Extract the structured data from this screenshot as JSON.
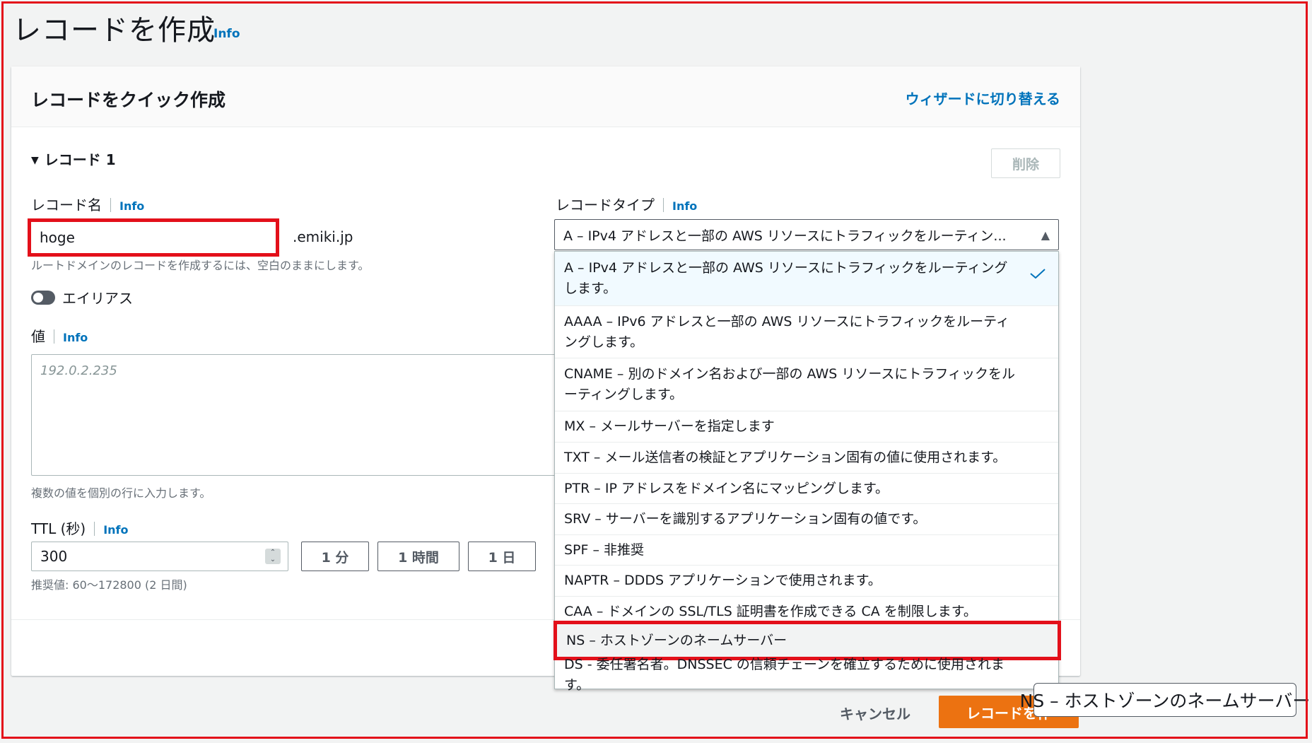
{
  "page": {
    "title": "レコードを作成",
    "info_label": "Info"
  },
  "panel": {
    "title": "レコードをクイック作成",
    "wizard_link": "ウィザードに切り替える"
  },
  "record": {
    "section_label": "レコード 1",
    "delete_label": "削除",
    "name": {
      "label": "レコード名",
      "info": "Info",
      "value": "hoge",
      "domain_suffix": ".emiki.jp",
      "hint": "ルートドメインのレコードを作成するには、空白のままにします。"
    },
    "alias": {
      "label": "エイリアス",
      "enabled": false
    },
    "value": {
      "label": "値",
      "info": "Info",
      "placeholder": "192.0.2.235",
      "hint": "複数の値を個別の行に入力します。"
    },
    "ttl": {
      "label": "TTL (秒)",
      "info": "Info",
      "value": "300",
      "presets": [
        "1 分",
        "1 時間",
        "1 日"
      ],
      "hint": "推奨値: 60～172800 (2 日間)"
    },
    "type": {
      "label": "レコードタイプ",
      "info": "Info",
      "selected": "A – IPv4 アドレスと一部の AWS リソースにトラフィックをルーティングします。",
      "selected_display": "A – IPv4 アドレスと一部の AWS リソースにトラフィックをルーティン...",
      "options": [
        "A – IPv4 アドレスと一部の AWS リソースにトラフィックをルーティングします。",
        "AAAA – IPv6 アドレスと一部の AWS リソースにトラフィックをルーティングします。",
        "CNAME – 別のドメイン名および一部の AWS リソースにトラフィックをルーティングします。",
        "MX – メールサーバーを指定します",
        "TXT – メール送信者の検証とアプリケーション固有の値に使用されます。",
        "PTR – IP アドレスをドメイン名にマッピングします。",
        "SRV – サーバーを識別するアプリケーション固有の値です。",
        "SPF – 非推奨",
        "NAPTR – DDDS アプリケーションで使用されます。",
        "CAA – ドメインの SSL/TLS 証明書を作成できる CA を制限します。",
        "NS – ホストゾーンのネームサーバー",
        "DS - 委任署名者。DNSSEC の信頼チェーンを確立するために使用されます。"
      ]
    }
  },
  "footer": {
    "cancel_label": "キャンセル",
    "create_label": "レコードを作"
  },
  "tooltip": {
    "text": "NS – ホストゾーンのネームサーバー"
  },
  "colors": {
    "link": "#0073bb",
    "primary_button": "#ec7211",
    "highlight": "#e3101a",
    "selected_option_bg": "#f1faff"
  }
}
